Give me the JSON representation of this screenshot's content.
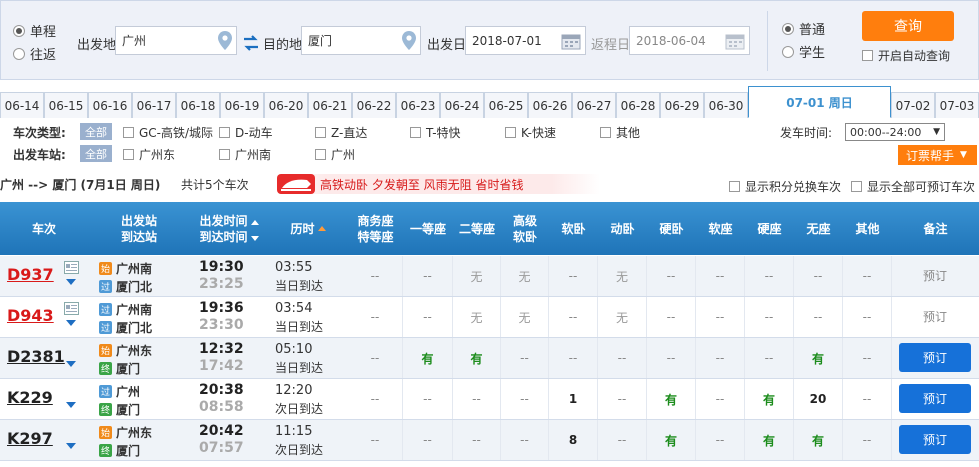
{
  "search": {
    "trip_types": [
      {
        "label": "单程",
        "selected": true
      },
      {
        "label": "往返",
        "selected": false
      }
    ],
    "from_label": "出发地",
    "from_value": "广州",
    "to_label": "目的地",
    "to_value": "厦门",
    "depart_label": "出发日",
    "depart_value": "2018-07-01",
    "return_label": "返程日",
    "return_value": "2018-06-04",
    "passenger_types": [
      {
        "label": "普通",
        "selected": true
      },
      {
        "label": "学生",
        "selected": false
      }
    ],
    "query_label": "查询",
    "auto_query_label": "开启自动查询"
  },
  "dates": [
    "06-14",
    "06-15",
    "06-16",
    "06-17",
    "06-18",
    "06-19",
    "06-20",
    "06-21",
    "06-22",
    "06-23",
    "06-24",
    "06-25",
    "06-26",
    "06-27",
    "06-28",
    "06-29",
    "06-30",
    "07-01 周日",
    "07-02",
    "07-03"
  ],
  "active_date": "07-01 周日",
  "filters": {
    "train_type_label": "车次类型:",
    "train_type_all": "全部",
    "train_types": [
      "GC-高铁/城际",
      "D-动车",
      "Z-直达",
      "T-特快",
      "K-快速",
      "其他"
    ],
    "station_label": "出发车站:",
    "station_all": "全部",
    "stations": [
      "广州东",
      "广州南",
      "广州"
    ],
    "depart_time_label": "发车时间:",
    "depart_time_value": "00:00--24:00",
    "helper_label": "订票帮手"
  },
  "summary": {
    "route": "广州 --> 厦门 (7月1日 周日)",
    "count": "共计5个车次",
    "banner": "高铁动卧 夕发朝至 风雨无阻 省时省钱",
    "opt_points": "显示积分兑换车次",
    "opt_all": "显示全部可预订车次"
  },
  "table": {
    "col_train": "车次",
    "col_station_1": "出发站",
    "col_station_2": "到达站",
    "col_time_1": "出发时间",
    "col_time_2": "到达时间",
    "col_duration": "历时",
    "col_business_1": "商务座",
    "col_business_2": "特等座",
    "col_first": "一等座",
    "col_second": "二等座",
    "col_high_1": "高级",
    "col_high_2": "软卧",
    "col_soft_sleeper": "软卧",
    "col_moving_sleeper": "动卧",
    "col_hard_sleeper": "硬卧",
    "col_soft_seat": "软座",
    "col_hard_seat": "硬座",
    "col_no_seat": "无座",
    "col_other": "其他",
    "col_remark": "备注"
  },
  "trains": [
    {
      "no": "D937",
      "red": true,
      "from_badge": "始",
      "from": "广州南",
      "to_badge": "过",
      "to": "厦门北",
      "dep": "19:30",
      "arr": "23:25",
      "dur": "03:55",
      "day": "当日到达",
      "seats": [
        "--",
        "--",
        "无",
        "无",
        "--",
        "无",
        "--",
        "--",
        "--",
        "--",
        "--"
      ],
      "remark": "预订",
      "bookable": false
    },
    {
      "no": "D943",
      "red": true,
      "from_badge": "过",
      "from": "广州南",
      "to_badge": "过",
      "to": "厦门北",
      "dep": "19:36",
      "arr": "23:30",
      "dur": "03:54",
      "day": "当日到达",
      "seats": [
        "--",
        "--",
        "无",
        "无",
        "--",
        "无",
        "--",
        "--",
        "--",
        "--",
        "--"
      ],
      "remark": "预订",
      "bookable": false
    },
    {
      "no": "D2381",
      "red": false,
      "from_badge": "始",
      "from": "广州东",
      "to_badge": "终",
      "to": "厦门",
      "dep": "12:32",
      "arr": "17:42",
      "dur": "05:10",
      "day": "当日到达",
      "seats": [
        "--",
        "有",
        "有",
        "--",
        "--",
        "--",
        "--",
        "--",
        "--",
        "有",
        "--"
      ],
      "remark": "预订",
      "bookable": true
    },
    {
      "no": "K229",
      "red": false,
      "from_badge": "过",
      "from": "广州",
      "to_badge": "终",
      "to": "厦门",
      "dep": "20:38",
      "arr": "08:58",
      "dur": "12:20",
      "day": "次日到达",
      "seats": [
        "--",
        "--",
        "--",
        "--",
        "1",
        "--",
        "有",
        "--",
        "有",
        "20",
        "--"
      ],
      "remark": "预订",
      "bookable": true
    },
    {
      "no": "K297",
      "red": false,
      "from_badge": "始",
      "from": "广州东",
      "to_badge": "终",
      "to": "厦门",
      "dep": "20:42",
      "arr": "07:57",
      "dur": "11:15",
      "day": "次日到达",
      "seats": [
        "--",
        "--",
        "--",
        "--",
        "8",
        "--",
        "有",
        "--",
        "有",
        "有",
        "--"
      ],
      "remark": "预订",
      "bookable": true
    }
  ],
  "colors": {
    "accent": "#3d91cf",
    "header": "#2a86c9",
    "orange": "#ff7e0d",
    "train_red": "#d91a1a",
    "available": "#1c8c1c",
    "book_button": "#1671d9"
  }
}
